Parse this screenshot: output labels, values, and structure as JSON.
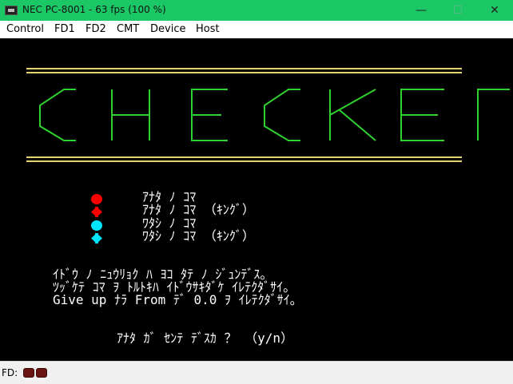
{
  "window": {
    "title": "NEC PC-8001 - 63 fps (100 %)",
    "icon": "pc-monitor-icon",
    "controls": {
      "minimize": "—",
      "maximize": "☐",
      "close": "✕"
    }
  },
  "menu": [
    "Control",
    "FD1",
    "FD2",
    "CMT",
    "Device",
    "Host"
  ],
  "screen": {
    "background": "#000000",
    "logo_text": "CHECKERS",
    "logo_color": "#2ed12e",
    "rule_color": "#e3d66e",
    "legend": [
      {
        "icon": "red-circle-piece-icon",
        "color": "#ff0000",
        "text": "ｱﾅﾀ ﾉ ｺﾏ"
      },
      {
        "icon": "red-diamond-king-icon",
        "color": "#ff0000",
        "text": "ｱﾅﾀ ﾉ ｺﾏ （ｷﾝｸﾞ）"
      },
      {
        "icon": "cyan-circle-piece-icon",
        "color": "#00e5ff",
        "text": "ﾜﾀｼ ﾉ ｺﾏ"
      },
      {
        "icon": "cyan-diamond-king-icon",
        "color": "#00e5ff",
        "text": "ﾜﾀｼ ﾉ ｺﾏ （ｷﾝｸﾞ）"
      }
    ],
    "instructions": [
      "ｲﾄﾞｳ ﾉ ﾆｭｳﾘｮｸ ﾊ ﾖｺ ﾀﾃ ﾉ ｼﾞｭﾝﾃﾞｽ。",
      "ﾂｯﾞｹﾃ ｺﾏ ｦ ﾄﾙﾄｷﾊ ｲﾄﾞｳｻｷﾀﾞｹ ｲﾚﾃｸﾀﾞｻｲ。",
      "Give up ﾅﾗ From ﾃﾞ 0.0 ｦ ｲﾚﾃｸﾀﾞｻｲ。"
    ],
    "prompt": "ｱﾅﾀ ｶﾞ ｾﾝﾃ ﾃﾞｽｶ ？ （y/n）"
  },
  "status": {
    "label": "FD:",
    "drive_leds": [
      "fd1-led-icon",
      "fd2-led-icon"
    ],
    "led_color": "#6b1414"
  }
}
